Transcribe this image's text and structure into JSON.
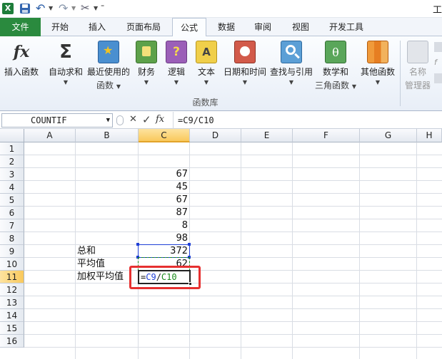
{
  "ribbon_tabs": [
    "文件",
    "开始",
    "插入",
    "页面布局",
    "公式",
    "数据",
    "审阅",
    "视图",
    "开发工具"
  ],
  "title_fragment": "工",
  "ribbon_buttons": [
    {
      "label": "插入函数",
      "label2": "",
      "icon": "fx-icon"
    },
    {
      "label": "自动求和",
      "label2": "",
      "icon": "sigma-icon"
    },
    {
      "label": "最近使用的",
      "label2": "函数",
      "icon": "star-book-icon"
    },
    {
      "label": "财务",
      "label2": "",
      "icon": "finance-book-icon"
    },
    {
      "label": "逻辑",
      "label2": "",
      "icon": "logic-book-icon"
    },
    {
      "label": "文本",
      "label2": "",
      "icon": "text-book-icon"
    },
    {
      "label": "日期和时间",
      "label2": "",
      "icon": "datetime-book-icon"
    },
    {
      "label": "查找与引用",
      "label2": "",
      "icon": "lookup-book-icon"
    },
    {
      "label": "数学和",
      "label2": "三角函数",
      "icon": "math-book-icon"
    },
    {
      "label": "其他函数",
      "label2": "",
      "icon": "more-books-icon"
    },
    {
      "label": "名称",
      "label2": "管理器",
      "icon": "name-manager-icon"
    }
  ],
  "group_label": "函数库",
  "formula_bar": {
    "name_box": "COUNTIF",
    "cancel": "✕",
    "enter": "✓",
    "fx": "fx",
    "formula": "=C9/C10"
  },
  "columns": [
    "A",
    "B",
    "C",
    "D",
    "E",
    "F",
    "G",
    "H"
  ],
  "rows": [
    "1",
    "2",
    "3",
    "4",
    "5",
    "6",
    "7",
    "8",
    "9",
    "10",
    "11",
    "12",
    "13",
    "14",
    "15",
    "16"
  ],
  "cells": {
    "C3": "67",
    "C4": "45",
    "C5": "67",
    "C6": "87",
    "C7": "8",
    "C8": "98",
    "B9": "总和",
    "C9": "372",
    "B10": "平均值",
    "C10": "62",
    "B11": "加权平均值",
    "C11_prefix": "=",
    "C11_ref1": "C9",
    "C11_op": "/",
    "C11_ref2": "C10"
  },
  "colors": {
    "file_tab": "#2a8a3e",
    "ref_blue": "#1f3fd6",
    "ref_green": "#1a8a1a",
    "highlight_box": "#e63030",
    "selected_header": "#fbd67a"
  }
}
